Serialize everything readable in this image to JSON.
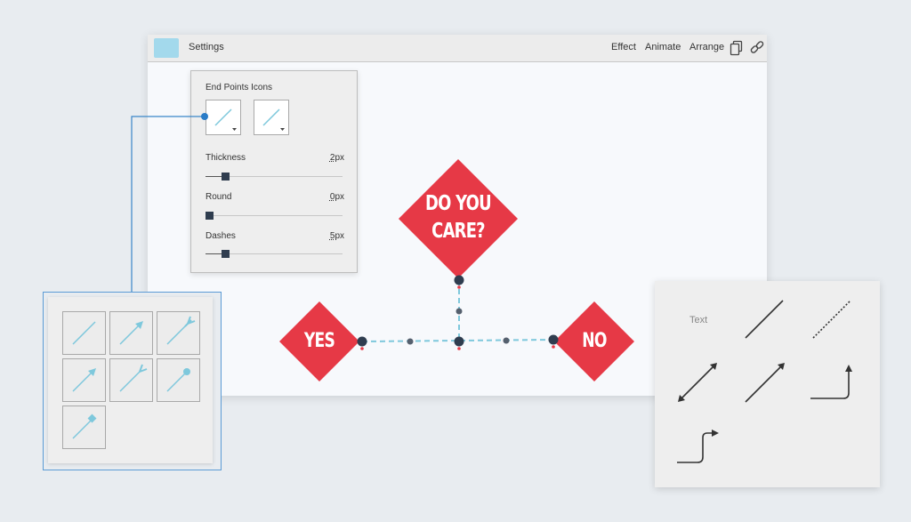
{
  "toolbar": {
    "title": "Settings",
    "effect": "Effect",
    "animate": "Animate",
    "arrange": "Arrange",
    "swatch_color": "#a3d9ec",
    "icons": [
      "copy-icon",
      "link-icon"
    ]
  },
  "settings_panel": {
    "heading": "End Points Icons",
    "thickness": {
      "label": "Thickness",
      "value": "2",
      "unit": "px",
      "level": 0.12
    },
    "round": {
      "label": "Round",
      "value": "0",
      "unit": "px",
      "level": 0.0
    },
    "dashes": {
      "label": "Dashes",
      "value": "5",
      "unit": "px",
      "level": 0.12
    }
  },
  "flowchart": {
    "question_line1": "DO YOU",
    "question_line2": "CARE?",
    "yes": "YES",
    "no": "NO",
    "diamond_color": "#e63946",
    "connector_color": "#7ec8dc"
  },
  "icons_panel": {
    "items": [
      "plain-line-icon",
      "arrow-line-icon",
      "fork-end-line-icon",
      "arrow-line-icon-2",
      "fork-end-line-icon-2",
      "dot-end-line-icon",
      "square-end-line-icon"
    ]
  },
  "shapes_panel": {
    "text_label": "Text",
    "items": [
      "solid-line-icon",
      "dashed-line-icon",
      "double-arrow-line-icon",
      "arrow-line-icon",
      "elbow-arrow-up-icon",
      "elbow-arrow-right-icon"
    ]
  }
}
